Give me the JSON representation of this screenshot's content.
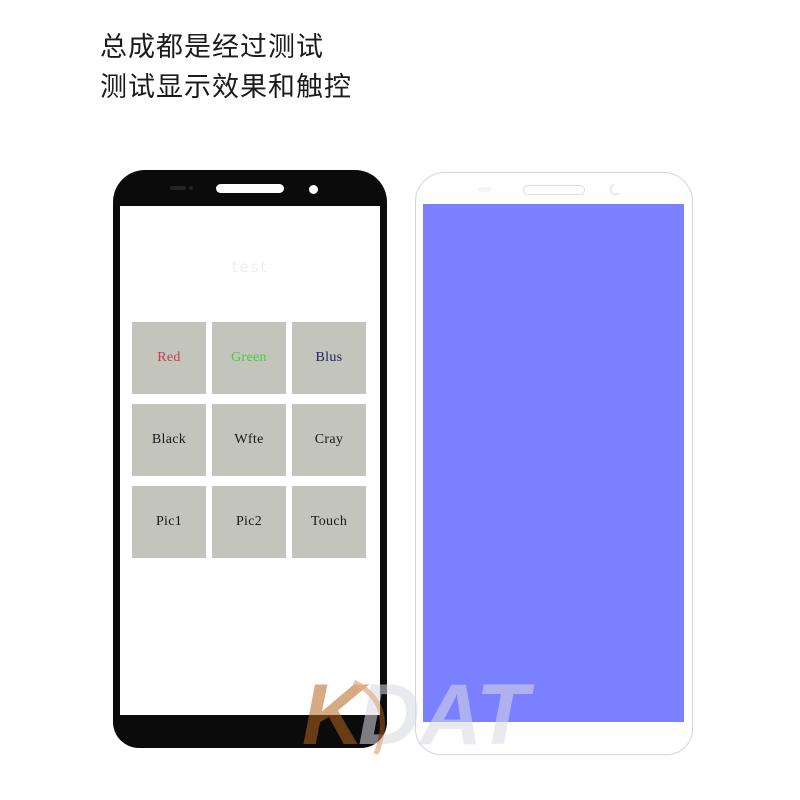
{
  "headline": {
    "line1": "总成都是经过测试",
    "line2": "测试显示效果和触控"
  },
  "colors": {
    "background": "#ffffff",
    "headline_text": "#1b1b1b",
    "left_phone_bezel": "#0b0b0b",
    "left_phone_screen": "#ffffff",
    "right_phone_body": "#fefefe",
    "right_phone_outline": "#d8d8d8",
    "right_phone_screen": "#7a80ff",
    "button_fill": "#c3c5bc",
    "button_text": "#16181a",
    "red_label": "#c1414b",
    "green_label": "#3fd03f",
    "blue_label": "#1c1f63",
    "watermark_orange": "#b5661f",
    "watermark_gray": "#d8dae4"
  },
  "left_phone": {
    "screen_watermark": "test",
    "test_grid": {
      "rows": [
        [
          {
            "label": "Red",
            "style": "red"
          },
          {
            "label": "Green",
            "style": "green"
          },
          {
            "label": "Blus",
            "style": "blue"
          }
        ],
        [
          {
            "label": "Black",
            "style": "plain"
          },
          {
            "label": "Wfte",
            "style": "plain"
          },
          {
            "label": "Cray",
            "style": "plain"
          }
        ],
        [
          {
            "label": "Pic1",
            "style": "plain"
          },
          {
            "label": "Pic2",
            "style": "plain"
          },
          {
            "label": "Touch",
            "style": "plain"
          }
        ]
      ]
    }
  },
  "right_phone": {
    "screen_state": "solid blue test pattern"
  },
  "watermark": {
    "text_primary": "K",
    "text_secondary": "DAT",
    "full": "KDAT"
  }
}
